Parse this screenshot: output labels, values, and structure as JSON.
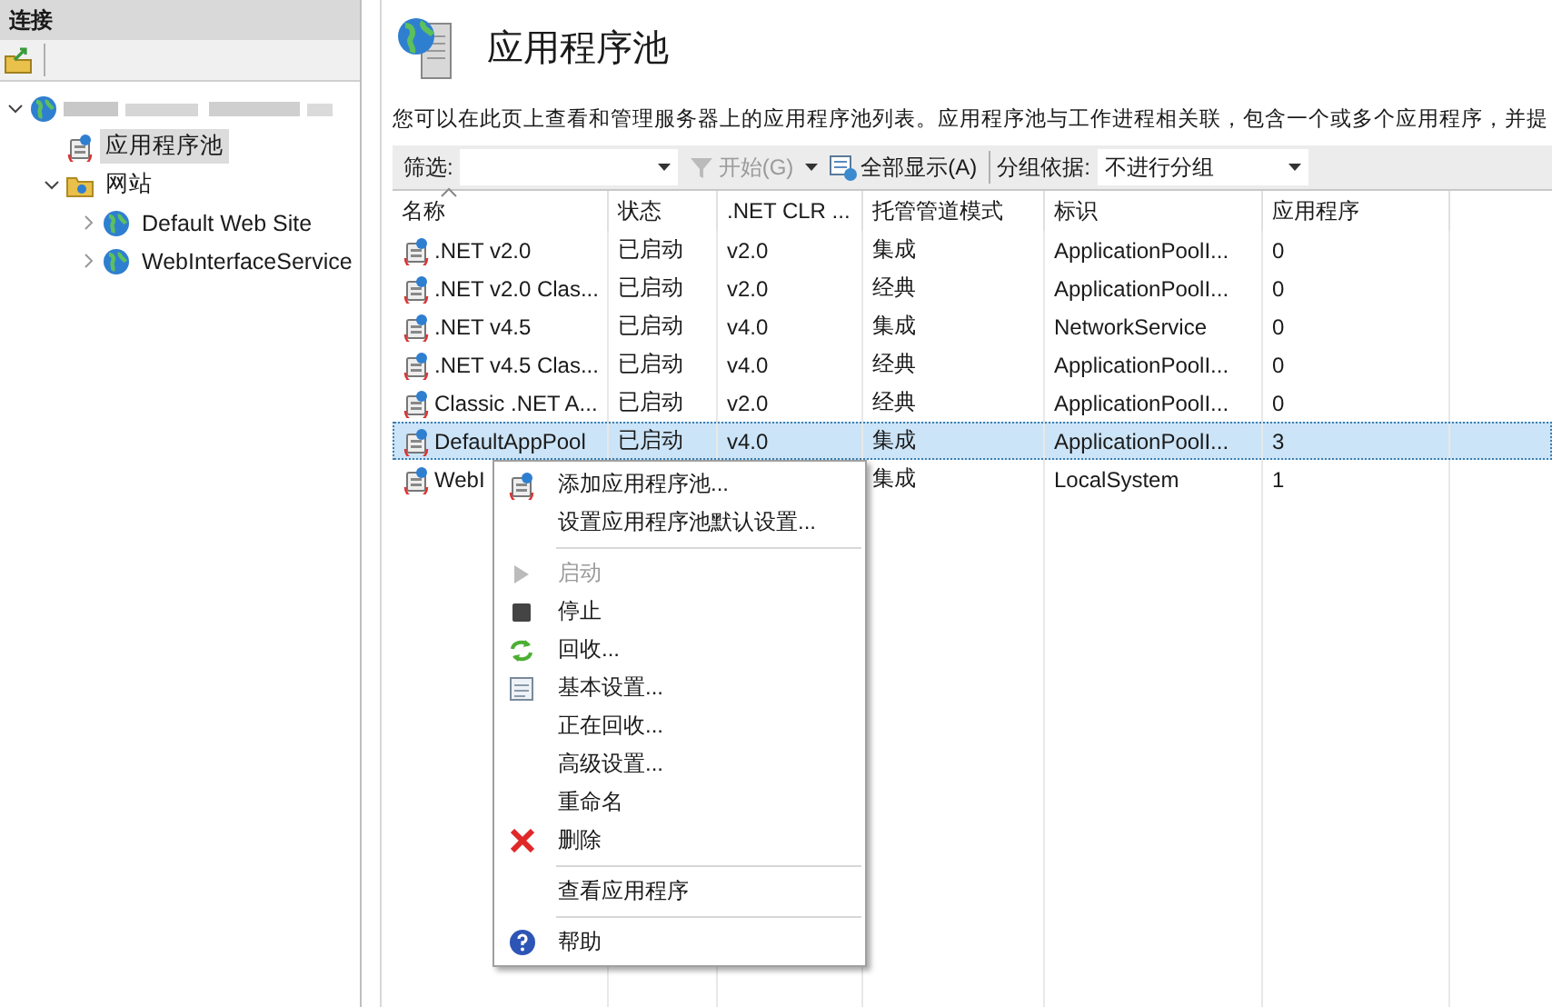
{
  "connections": {
    "title": "连接",
    "tree": [
      {
        "kind": "server",
        "expanded": true,
        "children": [
          {
            "kind": "pool",
            "label": "应用程序池",
            "selected": true
          },
          {
            "kind": "sites",
            "label": "网站",
            "selected": false,
            "expanded": true,
            "children": [
              {
                "kind": "site",
                "label": "Default Web Site",
                "selected": false,
                "expanded": false
              },
              {
                "kind": "site",
                "label": "WebInterfaceService",
                "selected": false,
                "expanded": false
              }
            ]
          }
        ]
      }
    ]
  },
  "page": {
    "title": "应用程序池",
    "description": "您可以在此页上查看和管理服务器上的应用程序池列表。应用程序池与工作进程相关联，包含一个或多个应用程序，并提"
  },
  "toolbar": {
    "filter_label": "筛选:",
    "start_button": {
      "label": "开始(G)",
      "disabled": true
    },
    "show_all_button": "全部显示(A)",
    "group_label": "分组依据:",
    "group_value": "不进行分组"
  },
  "table": {
    "columns": [
      "名称",
      "状态",
      ".NET CLR ...",
      "托管管道模式",
      "标识",
      "应用程序"
    ],
    "rows": [
      {
        "selected": false,
        "cells": [
          ".NET v2.0",
          "已启动",
          "v2.0",
          "集成",
          "ApplicationPoolI...",
          "0"
        ]
      },
      {
        "selected": false,
        "cells": [
          ".NET v2.0 Clas...",
          "已启动",
          "v2.0",
          "经典",
          "ApplicationPoolI...",
          "0"
        ]
      },
      {
        "selected": false,
        "cells": [
          ".NET v4.5",
          "已启动",
          "v4.0",
          "集成",
          "NetworkService",
          "0"
        ]
      },
      {
        "selected": false,
        "cells": [
          ".NET v4.5 Clas...",
          "已启动",
          "v4.0",
          "经典",
          "ApplicationPoolI...",
          "0"
        ]
      },
      {
        "selected": false,
        "cells": [
          "Classic .NET A...",
          "已启动",
          "v2.0",
          "经典",
          "ApplicationPoolI...",
          "0"
        ]
      },
      {
        "selected": true,
        "cells": [
          "DefaultAppPool",
          "已启动",
          "v4.0",
          "集成",
          "ApplicationPoolI...",
          "3"
        ]
      },
      {
        "selected": false,
        "cells": [
          "WebI",
          null,
          null,
          "集成",
          "LocalSystem",
          "1"
        ]
      }
    ]
  },
  "context_menu": [
    {
      "kind": "add",
      "label": "添加应用程序池...",
      "disabled": false
    },
    {
      "kind": "plain",
      "label": "设置应用程序池默认设置...",
      "disabled": false
    },
    {
      "kind": "separator"
    },
    {
      "kind": "start",
      "label": "启动",
      "disabled": true
    },
    {
      "kind": "stop",
      "label": "停止",
      "disabled": false
    },
    {
      "kind": "recycle",
      "label": "回收...",
      "disabled": false
    },
    {
      "kind": "basic",
      "label": "基本设置...",
      "disabled": false
    },
    {
      "kind": "plain",
      "label": "正在回收...",
      "disabled": false
    },
    {
      "kind": "plain",
      "label": "高级设置...",
      "disabled": false
    },
    {
      "kind": "plain",
      "label": "重命名",
      "disabled": false
    },
    {
      "kind": "delete",
      "label": "删除",
      "disabled": false
    },
    {
      "kind": "separator"
    },
    {
      "kind": "plain",
      "label": "查看应用程序",
      "disabled": false
    },
    {
      "kind": "separator"
    },
    {
      "kind": "help",
      "label": "帮助",
      "disabled": false
    }
  ]
}
